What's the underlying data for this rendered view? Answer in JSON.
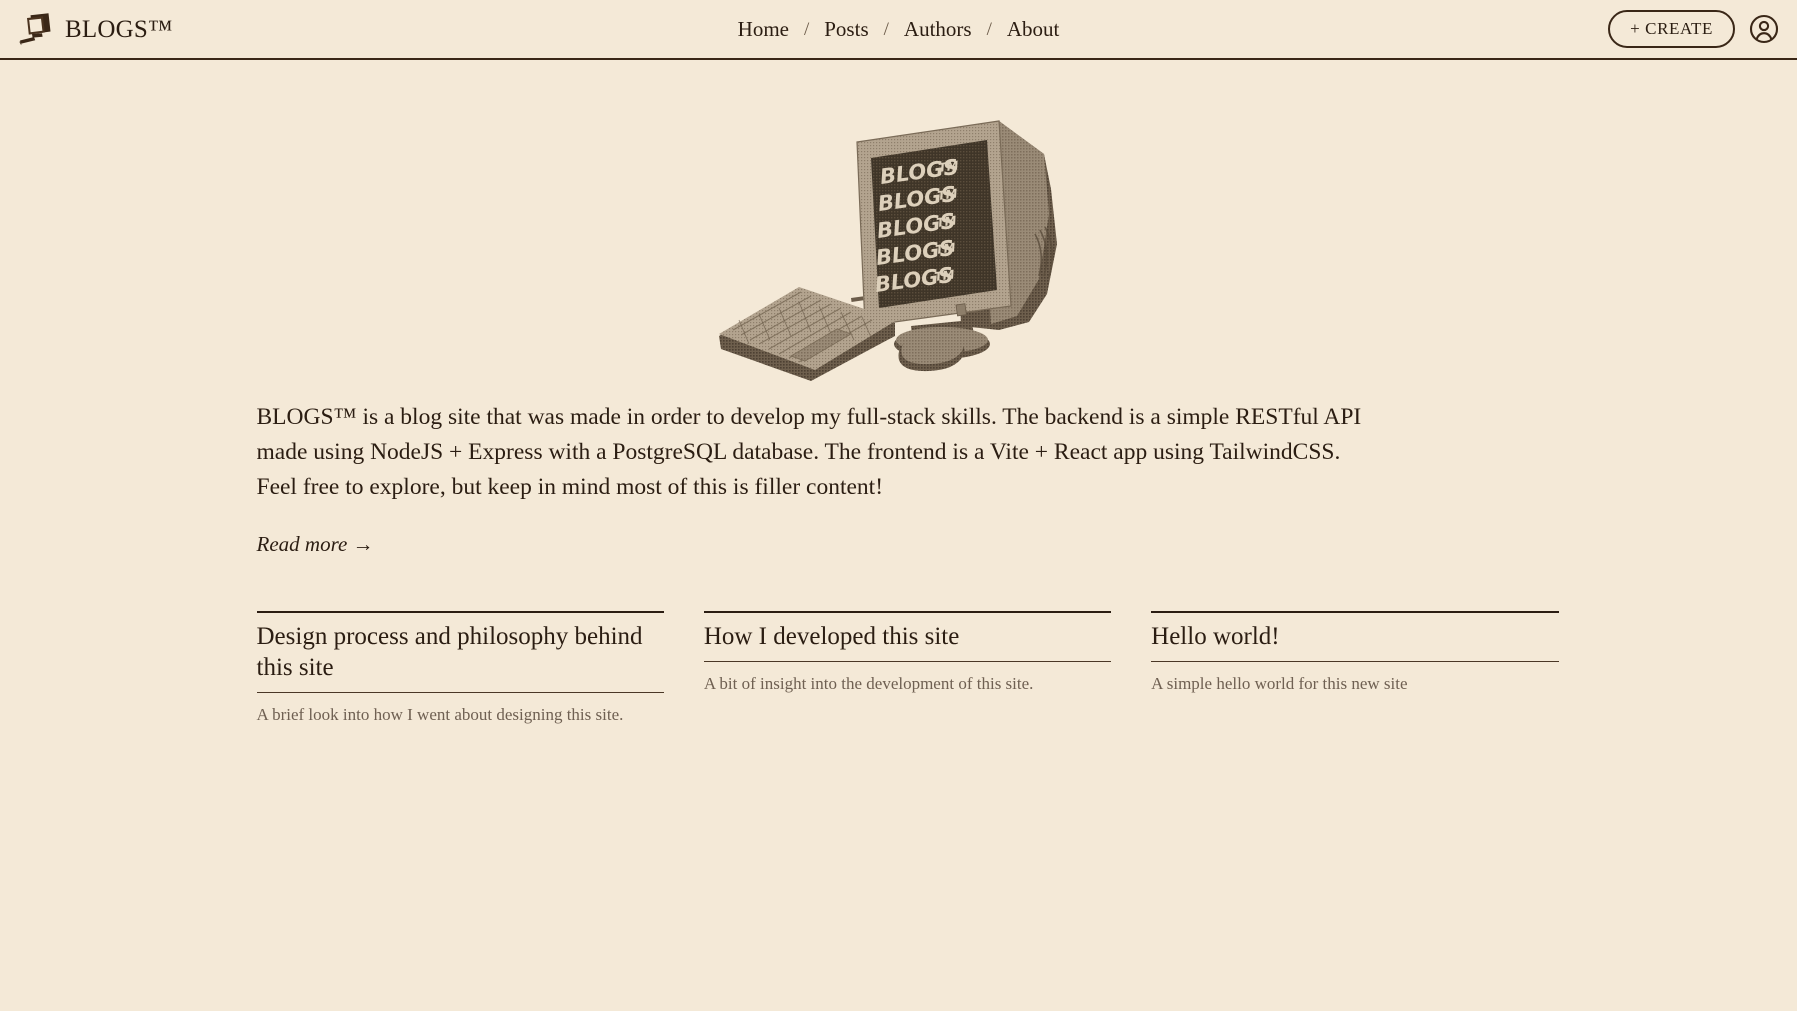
{
  "header": {
    "brand_name": "BLOGS™",
    "brand_icon": "computer-monitor-icon",
    "nav": [
      {
        "label": "Home"
      },
      {
        "label": "Posts"
      },
      {
        "label": "Authors"
      },
      {
        "label": "About"
      }
    ],
    "nav_separator": "/",
    "create_label": "+ CREATE",
    "account_icon": "user-account-icon"
  },
  "hero": {
    "alt": "halftone CRT computer monitor with keyboard and mouse",
    "screen_lines": [
      "BLOGS™",
      "BLOGS™",
      "BLOGS™",
      "BLOGS™",
      "BLOGS™"
    ]
  },
  "main": {
    "intro": "BLOGS™ is a blog site that was made in order to develop my full-stack skills. The backend is a simple RESTful API made using NodeJS + Express with a PostgreSQL database. The frontend is a Vite + React app using TailwindCSS. Feel free to explore, but keep in mind most of this is filler content!",
    "read_more": "Read more →"
  },
  "posts": [
    {
      "title": "Design process and philosophy behind this site",
      "description": "A brief look into how I went about designing this site."
    },
    {
      "title": "How I developed this site",
      "description": "A bit of insight into the development of this site."
    },
    {
      "title": "Hello world!",
      "description": "A simple hello world for this new site"
    }
  ],
  "colors": {
    "background": "#f4e9d7",
    "text": "#2b1d12",
    "muted_text": "#6f6052",
    "border": "#3a2717",
    "halftone_light": "#b8a894",
    "halftone_dark": "#6d5b48"
  }
}
